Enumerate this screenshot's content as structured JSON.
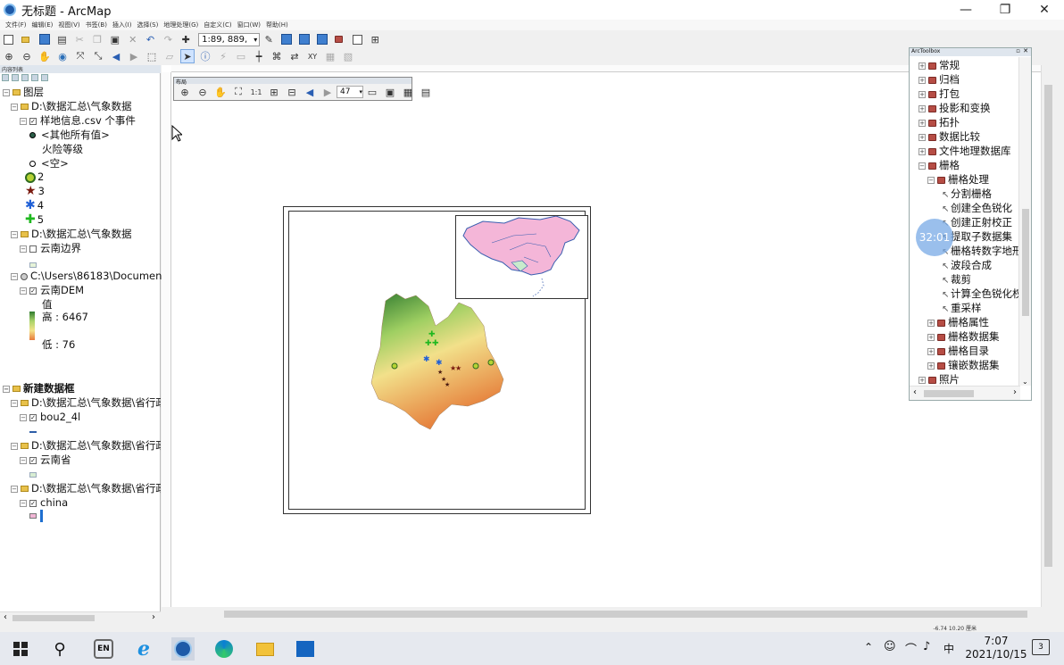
{
  "window": {
    "title": "无标题 - ArcMap",
    "min": "—",
    "restore": "❐",
    "close": "✕"
  },
  "menu": [
    "文件(F)",
    "编辑(E)",
    "视图(V)",
    "书签(B)",
    "插入(I)",
    "选择(S)",
    "地理处理(G)",
    "自定义(C)",
    "窗口(W)",
    "帮助(H)"
  ],
  "toolbar": {
    "scale": "1:89, 889,"
  },
  "toc": {
    "title": "内容列表",
    "rows": [
      {
        "label": "图层",
        "indent": 0
      },
      {
        "label": "D:\\数据汇总\\气象数据",
        "indent": 1
      },
      {
        "label": "样地信息.csv 个事件",
        "indent": 2
      },
      {
        "label": "<其他所有值>",
        "indent": 3
      },
      {
        "label": "火险等级",
        "indent": 3
      },
      {
        "label": "<空>",
        "indent": 3
      },
      {
        "label": "2",
        "indent": 3
      },
      {
        "label": "3",
        "indent": 3
      },
      {
        "label": "4",
        "indent": 3
      },
      {
        "label": "5",
        "indent": 3
      },
      {
        "label": "D:\\数据汇总\\气象数据",
        "indent": 1
      },
      {
        "label": "云南边界",
        "indent": 2
      },
      {
        "label": "C:\\Users\\86183\\Documents\\",
        "indent": 1
      },
      {
        "label": "云南DEM",
        "indent": 2
      },
      {
        "label": "值",
        "indent": 3
      },
      {
        "label": "高 : 6467",
        "indent": 3
      },
      {
        "label": "低 : 76",
        "indent": 3
      },
      {
        "label": "新建数据框",
        "indent": 0
      },
      {
        "label": "D:\\数据汇总\\气象数据\\省行政",
        "indent": 1
      },
      {
        "label": "bou2_4l",
        "indent": 2
      },
      {
        "label": "D:\\数据汇总\\气象数据\\省行政",
        "indent": 1
      },
      {
        "label": "云南省",
        "indent": 2
      },
      {
        "label": "D:\\数据汇总\\气象数据\\省行政",
        "indent": 1
      },
      {
        "label": "china",
        "indent": 2
      }
    ]
  },
  "layout_toolbar": {
    "title": "布局",
    "zoom": "47"
  },
  "status": {
    "coords": "-6.74  10.20 厘米"
  },
  "arctoolbox": {
    "title": "ArcToolbox",
    "items": [
      {
        "label": "常规",
        "level": 0,
        "exp": "+"
      },
      {
        "label": "归档",
        "level": 0,
        "exp": "+"
      },
      {
        "label": "打包",
        "level": 0,
        "exp": "+"
      },
      {
        "label": "投影和变换",
        "level": 0,
        "exp": "+"
      },
      {
        "label": "拓扑",
        "level": 0,
        "exp": "+"
      },
      {
        "label": "数据比较",
        "level": 0,
        "exp": "+"
      },
      {
        "label": "文件地理数据库",
        "level": 0,
        "exp": "+"
      },
      {
        "label": "栅格",
        "level": 0,
        "exp": "−"
      },
      {
        "label": "栅格处理",
        "level": 1,
        "exp": "−"
      },
      {
        "label": "分割栅格",
        "level": 2,
        "exp": ""
      },
      {
        "label": "创建全色锐化",
        "level": 2,
        "exp": ""
      },
      {
        "label": "创建正射校正",
        "level": 2,
        "exp": ""
      },
      {
        "label": "提取子数据集",
        "level": 2,
        "exp": ""
      },
      {
        "label": "栅格转数字地形",
        "level": 2,
        "exp": ""
      },
      {
        "label": "波段合成",
        "level": 2,
        "exp": ""
      },
      {
        "label": "裁剪",
        "level": 2,
        "exp": ""
      },
      {
        "label": "计算全色锐化权",
        "level": 2,
        "exp": ""
      },
      {
        "label": "重采样",
        "level": 2,
        "exp": ""
      },
      {
        "label": "栅格属性",
        "level": 1,
        "exp": "+"
      },
      {
        "label": "栅格数据集",
        "level": 1,
        "exp": "+"
      },
      {
        "label": "栅格目录",
        "level": 1,
        "exp": "+"
      },
      {
        "label": "镶嵌数据集",
        "level": 1,
        "exp": "+"
      },
      {
        "label": "照片",
        "level": 0,
        "exp": "+"
      }
    ]
  },
  "timer": "32:01",
  "taskbar": {
    "time": "7:07",
    "date": "2021/10/15",
    "ime": "中",
    "lang_badge": "EN",
    "notif_count": "3"
  },
  "colors": {
    "accent": "#1e5aa8",
    "dem_high": "#2f7a2f",
    "dem_low": "#e87a3a"
  }
}
